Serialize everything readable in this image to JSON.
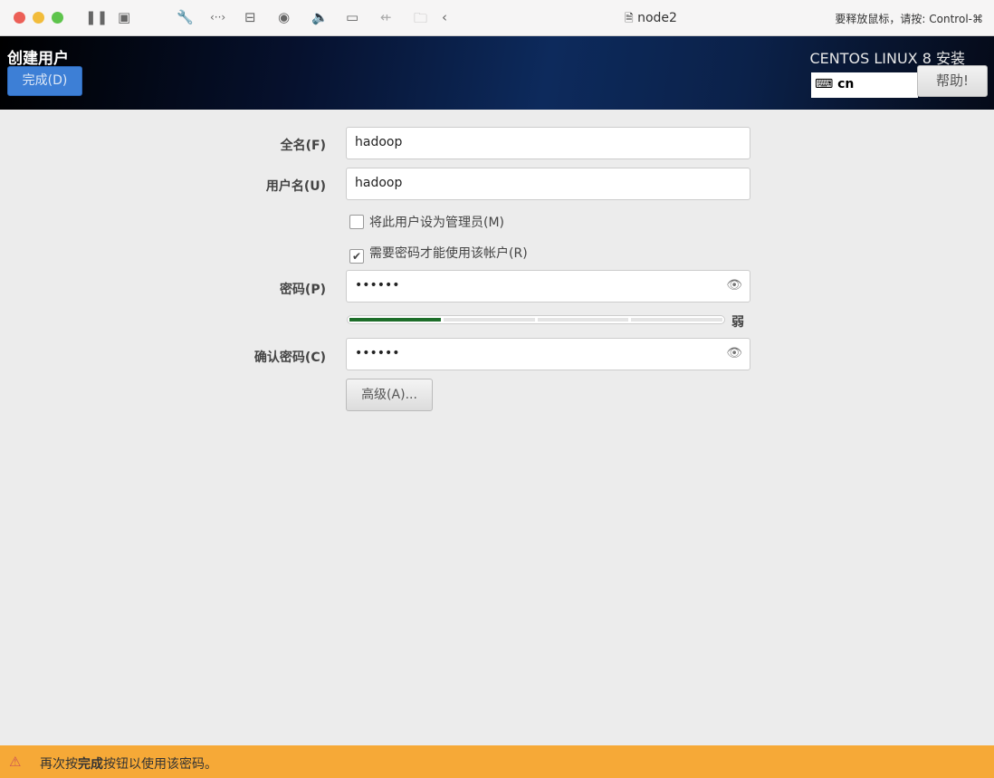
{
  "window": {
    "title": "node2",
    "release_hint": "要释放鼠标，请按: Control-⌘",
    "toolbar_icons": [
      "pause-icon",
      "snapshot-icon",
      "wrench-icon",
      "network-icon",
      "disk-icon",
      "camera-icon",
      "speaker-icon",
      "video-icon",
      "usb-icon",
      "shared-folder-icon",
      "chevron-left-icon"
    ]
  },
  "header": {
    "title": "创建用户",
    "done_label": "完成(D)",
    "product": "CENTOS LINUX 8 安装",
    "keyboard_layout": "cn",
    "help_label": "帮助!"
  },
  "form": {
    "fullname_label": "全名(F)",
    "fullname_value": "hadoop",
    "username_label": "用户名(U)",
    "username_value": "hadoop",
    "admin_label": "将此用户设为管理员(M)",
    "admin_checked": false,
    "require_pw_label": "需要密码才能使用该帐户(R)",
    "require_pw_checked": true,
    "password_label": "密码(P)",
    "password_value": "••••••",
    "strength_fraction": 0.25,
    "strength_label": "弱",
    "strength_color": "#1e6e2a",
    "confirm_label": "确认密码(C)",
    "confirm_value": "••••••",
    "advanced_label": "高级(A)..."
  },
  "status": {
    "prefix": "再次按",
    "bold": "完成",
    "suffix": "按钮以使用该密码。",
    "color": "#f6a937"
  }
}
